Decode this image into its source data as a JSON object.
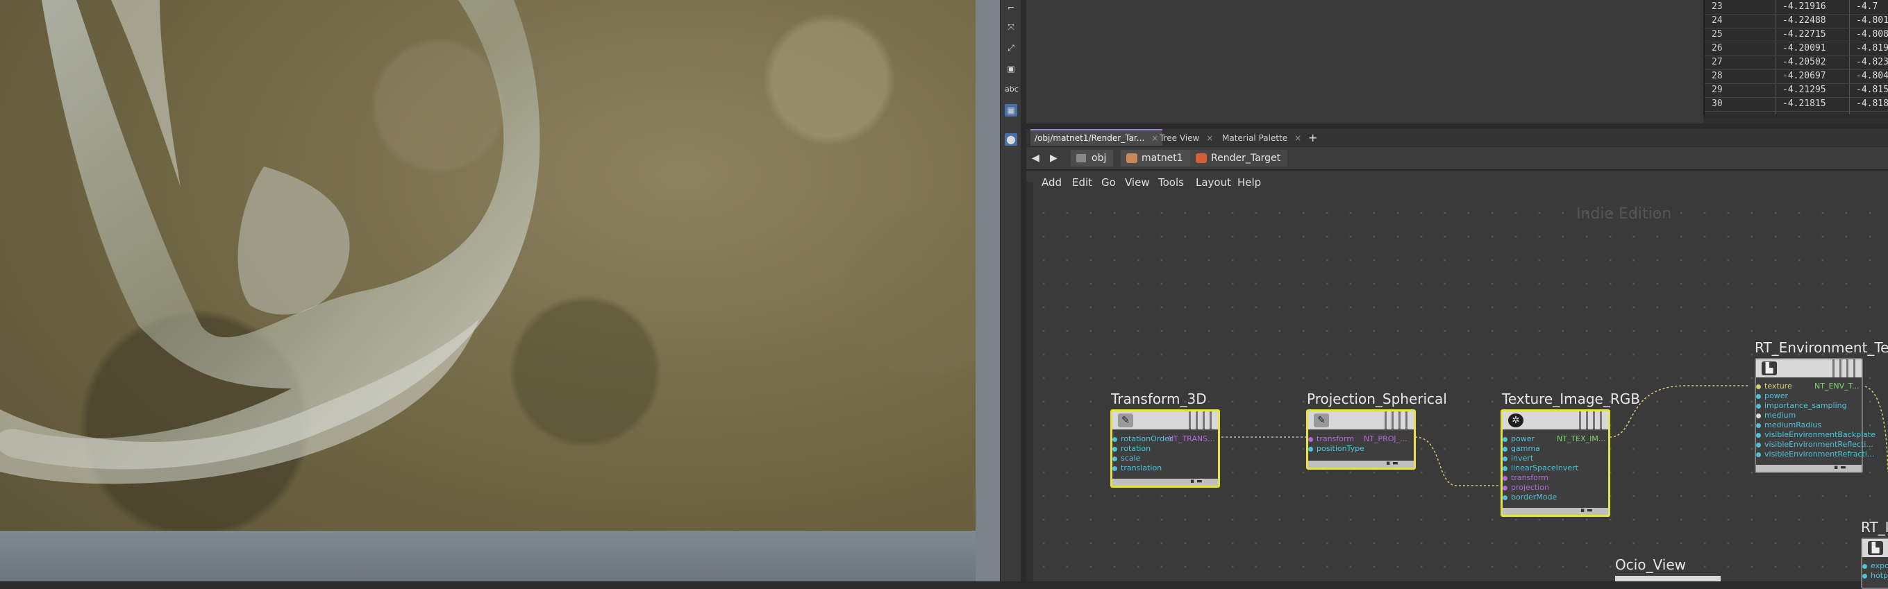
{
  "viewport": {
    "toolbar_icons": [
      "select-icon",
      "transform-icon",
      "handle-icon",
      "box-icon",
      "text-icon",
      "display-icon",
      "pin-icon"
    ],
    "abc_label": "abc"
  },
  "spreadsheet": {
    "rows": [
      {
        "idx": "23",
        "v1": "-4.21916",
        "v2": "-4.7"
      },
      {
        "idx": "24",
        "v1": "-4.22488",
        "v2": "-4.801"
      },
      {
        "idx": "25",
        "v1": "-4.22715",
        "v2": "-4.808"
      },
      {
        "idx": "26",
        "v1": "-4.20091",
        "v2": "-4.819"
      },
      {
        "idx": "27",
        "v1": "-4.20502",
        "v2": "-4.823"
      },
      {
        "idx": "28",
        "v1": "-4.20697",
        "v2": "-4.804"
      },
      {
        "idx": "29",
        "v1": "-4.21295",
        "v2": "-4.815"
      },
      {
        "idx": "30",
        "v1": "-4.21815",
        "v2": "-4.818"
      }
    ]
  },
  "network": {
    "tabs": [
      {
        "label": "/obj/matnet1/Render_Tar...",
        "close": "×"
      },
      {
        "label": "Tree View",
        "close": "×"
      },
      {
        "label": "Material Palette",
        "close": "×"
      }
    ],
    "add_tab": "+",
    "back": "◀",
    "forward": "▶",
    "breadcrumbs": [
      "obj",
      "matnet1",
      "Render_Target"
    ],
    "menu": [
      "Add",
      "Edit",
      "Go",
      "View",
      "Tools",
      "Layout",
      "Help"
    ],
    "watermark": "Indie Edition",
    "nodes": {
      "transform": {
        "title": "Transform_3D",
        "inputs": [
          "rotationOrder",
          "rotation",
          "scale",
          "translation"
        ],
        "output": "NT_TRANS..."
      },
      "projection": {
        "title": "Projection_Spherical",
        "inputs": [
          "transform",
          "positionType"
        ],
        "output": "NT_PROJ_..."
      },
      "texture": {
        "title": "Texture_Image_RGB",
        "inputs": [
          "power",
          "gamma",
          "invert",
          "linearSpaceInvert",
          "transform",
          "projection",
          "borderMode"
        ],
        "output": "NT_TEX_IM..."
      },
      "environment": {
        "title": "RT_Environment_Tex",
        "inputs": [
          "texture",
          "power",
          "importance_sampling",
          "medium",
          "mediumRadius",
          "visibleEnvironmentBackplate",
          "visibleEnvironmentReflecti...",
          "visibleEnvironmentRefracti..."
        ],
        "output": "NT_ENV_T..."
      },
      "ocio": {
        "title": "Ocio_View"
      },
      "rt_partial": {
        "title": "RT_I",
        "inputs": [
          "expos",
          "hotpi"
        ]
      }
    },
    "colors": {
      "selected_border": "#e6e24a",
      "wire": "#d8d070",
      "port_cyan": "#4fc3d9",
      "port_purple": "#b06bdc",
      "output_green": "#7fd36f"
    }
  }
}
